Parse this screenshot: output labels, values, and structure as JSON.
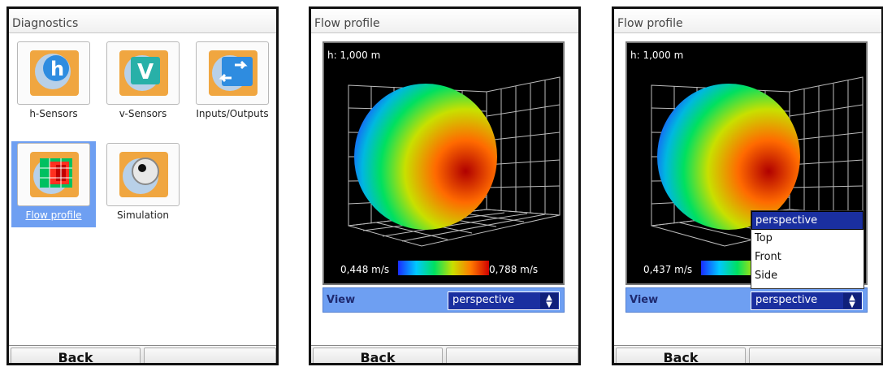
{
  "diagnostics": {
    "title": "Diagnostics",
    "tiles": [
      {
        "label": "h-Sensors"
      },
      {
        "label": "v-Sensors"
      },
      {
        "label": "Inputs/Outputs"
      },
      {
        "label": "Flow profile"
      },
      {
        "label": "Simulation"
      }
    ],
    "selected_tile": "Flow profile",
    "back_label": "Back"
  },
  "flow1": {
    "title": "Flow profile",
    "height_label": "h: 1,000 m",
    "vmin": "0,448 m/s",
    "vmax": "0,788 m/s",
    "view_label": "View",
    "view_value": "perspective",
    "back_label": "Back"
  },
  "flow2": {
    "title": "Flow profile",
    "height_label": "h: 1,000 m",
    "vmin": "0,437 m/s",
    "view_label": "View",
    "view_value": "perspective",
    "options": [
      "perspective",
      "Top",
      "Front",
      "Side"
    ],
    "back_label": "Back"
  },
  "colors": {
    "selection": "#6e9ff2",
    "select_bg": "#1a2fa0"
  }
}
